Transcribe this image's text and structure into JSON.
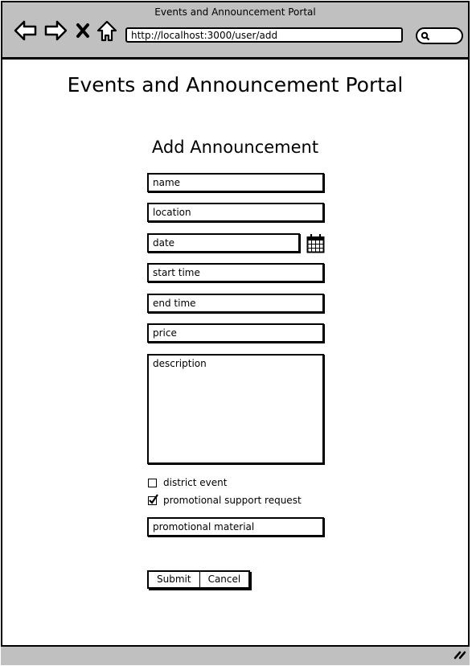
{
  "browser": {
    "window_title": "Events and Announcement Portal",
    "url": "http://localhost:3000/user/add",
    "nav": {
      "back_icon": "arrow-left-icon",
      "forward_icon": "arrow-right-icon",
      "stop_icon": "close-icon",
      "home_icon": "home-icon"
    },
    "search_icon": "search-icon"
  },
  "page": {
    "title": "Events and Announcement Portal",
    "form_title": "Add Announcement"
  },
  "form": {
    "fields": {
      "name": "name",
      "location": "location",
      "date": "date",
      "start_time": "start time",
      "end_time": "end time",
      "price": "price",
      "description": "description",
      "promotional_material": "promotional material"
    },
    "date_picker_icon": "calendar-icon",
    "checkboxes": {
      "district_event": {
        "label": "district event",
        "checked": false
      },
      "promotional_support": {
        "label": "promotional support request",
        "checked": true
      }
    },
    "buttons": {
      "submit": "Submit",
      "cancel": "Cancel"
    }
  },
  "statusbar": {
    "resize_icon": "resize-grip-icon"
  }
}
